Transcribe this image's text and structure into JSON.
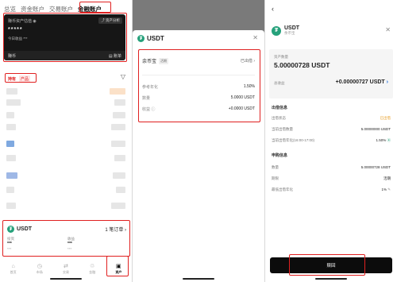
{
  "colors": {
    "accent": "#e02020",
    "usdt": "#26a17b",
    "dark": "#161616"
  },
  "panel1": {
    "tabs": [
      "总览",
      "资金账户",
      "交易账户",
      "金融账户"
    ],
    "active_tab": "金融账户",
    "card": {
      "title": "赚币资产估值",
      "analysis_btn": "资产分析",
      "value": "*****",
      "today_pnl": "今日收益 ***",
      "bottom_left": "赚币",
      "bottom_right": "账单"
    },
    "filters": {
      "holding": "持有",
      "product": "产品"
    },
    "asset": {
      "name": "USDT",
      "orders": "1 笔订单",
      "col1_label": "投资",
      "col1_value": "***",
      "col1_sub": "***",
      "col2_label": "收益",
      "col2_value": "***",
      "col2_sub": "***"
    },
    "nav": [
      "首页",
      "市场",
      "交易",
      "金融",
      "资产"
    ],
    "nav_active": "资产"
  },
  "panel2": {
    "title": "USDT",
    "product": {
      "name": "余币宝",
      "tag": "活期",
      "status": "已出借",
      "chevron": "›"
    },
    "ref_rate_label": "参考年化",
    "ref_rate": "1.50%",
    "amount_label": "数量",
    "amount": "5.0000 USDT",
    "earnings_label": "收益",
    "earnings": "+0.0000 USDT"
  },
  "panel3": {
    "title": "USDT",
    "subtitle": "余币宝",
    "qty_label": "资产数量",
    "qty": "5.00000728 USDT",
    "total_earnings_label": "总收益",
    "total_earnings": "+0.00000727 USDT",
    "lend_section": "出借信息",
    "lend_rows": [
      {
        "label": "出借状态",
        "value": "已出借"
      },
      {
        "label": "当前出借数量",
        "value": "5.00000000 USDT"
      },
      {
        "label": "当前出借年化(16:00-17:00)",
        "value": "1.50%"
      }
    ],
    "sub_section": "申购信息",
    "sub_rows": [
      {
        "label": "数量",
        "value": "5.00000728 USDT"
      },
      {
        "label": "期限",
        "value": "活期"
      },
      {
        "label": "最低出借年化",
        "value": "1%"
      }
    ],
    "return_btn": "赎回"
  }
}
